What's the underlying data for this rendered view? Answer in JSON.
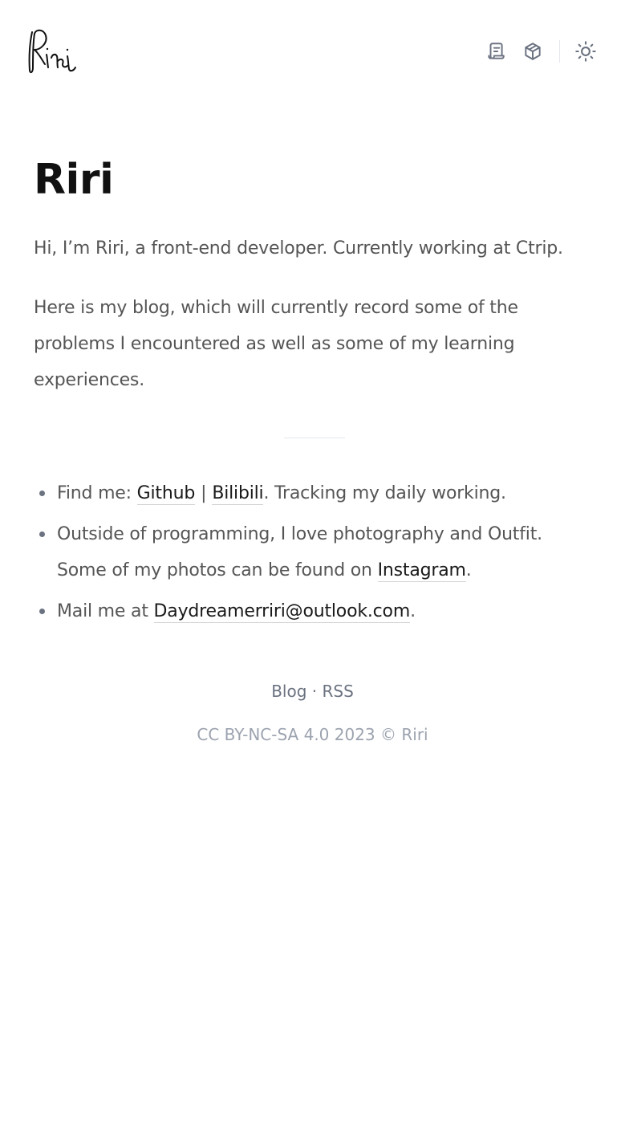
{
  "header": {
    "logo_text": "Riri",
    "nav": [
      {
        "icon": "blog-scroll-icon"
      },
      {
        "icon": "projects-cube-icon"
      },
      {
        "icon": "theme-sun-icon"
      }
    ]
  },
  "main": {
    "title": "Riri",
    "intro_1": "Hi, I’m Riri, a front-end developer. Currently working at Ctrip.",
    "intro_2": "Here is my blog, which will currently record some of the problems I encountered as well as some of my learning experiences.",
    "items": {
      "find_prefix": "Find me: ",
      "github": "Github",
      "separator": "|",
      "bilibili": "Bilibili",
      "find_suffix": ". Tracking my daily working.",
      "photo_text": "Outside of programming, I love photography and Outfit. Some of my photos can be found on ",
      "instagram": "Instagram",
      "photo_suffix": ".",
      "mail_prefix": "Mail me at ",
      "email": "Daydreamerriri@outlook.com",
      "mail_suffix": "."
    }
  },
  "footer": {
    "blog": "Blog",
    "dot": " · ",
    "rss": "RSS",
    "copyright": "CC BY-NC-SA 4.0 2023 © Riri"
  },
  "colors": {
    "title": "#111111",
    "body_text": "#555555",
    "icon": "#6b7280",
    "footer_muted": "#9ca3af"
  }
}
